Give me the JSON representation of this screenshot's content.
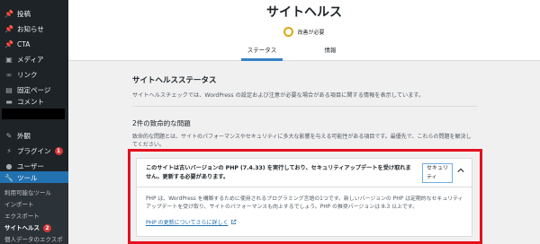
{
  "sidebar": {
    "items": [
      {
        "label": "投稿",
        "icon": "pin-icon",
        "glyph": "📌"
      },
      {
        "label": "お知らせ",
        "icon": "pin-icon",
        "glyph": "📌"
      },
      {
        "label": "CTA",
        "icon": "pin-icon",
        "glyph": "📌"
      },
      {
        "label": "メディア",
        "icon": "media-icon",
        "glyph": "▣"
      },
      {
        "label": "リンク",
        "icon": "link-icon",
        "glyph": "∞"
      },
      {
        "label": "固定ページ",
        "icon": "page-icon",
        "glyph": "▤"
      },
      {
        "label": "コメント",
        "icon": "comment-icon",
        "glyph": "▬"
      }
    ],
    "items2": [
      {
        "label": "外観",
        "icon": "appearance-icon",
        "glyph": "✎"
      },
      {
        "label": "プラグイン",
        "icon": "plugin-icon",
        "glyph": "⚡",
        "badge": "1"
      },
      {
        "label": "ユーザー",
        "icon": "user-icon",
        "glyph": "●"
      },
      {
        "label": "ツール",
        "icon": "tools-icon",
        "glyph": "🔧",
        "active": true
      }
    ],
    "submenu": [
      {
        "label": "利用可能なツール"
      },
      {
        "label": "インポート"
      },
      {
        "label": "エクスポート"
      },
      {
        "label": "サイトヘルス",
        "badge": "2",
        "current": true
      },
      {
        "label": "個人データのエクスポ"
      }
    ]
  },
  "header": {
    "title": "サイトヘルス",
    "status": "改善が必要",
    "status_color": "#dba617",
    "tabs": [
      {
        "label": "ステータス",
        "active": true
      },
      {
        "label": "情報"
      }
    ]
  },
  "main": {
    "section_title": "サイトヘルスステータス",
    "section_desc": "サイトヘルスチェックでは、WordPress の設定および注意が必要な場合がある項目に関する情報を表示しています。",
    "issues_title": "2件の致命的な問題",
    "issues_desc": "致命的な問題とは、サイトのパフォーマンスやセキュリティに多大な影響を与える可能性がある項目です。最優先で、これらの問題を解決してください。",
    "issue": {
      "heading": "このサイトは古いバージョンの PHP (7.4.33) を実行しており、セキュリティアップデートを受け取れません。更新する必要があります。",
      "badge": "セキュリティ",
      "body": "PHP は、WordPress を構築するために使用されるプログラミング言語の1つです。新しいバージョンの PHP は定期的なセキュリティアップデートを受け取り、サイトのパフォーマンスも向上するでしょう。PHP の推奨バージョンは 8.3 以上です。",
      "link": "PHP の更新についてさらに詳しく"
    }
  },
  "colors": {
    "sidebar_bg": "#1d2327",
    "accent": "#2271b1",
    "highlight": "#e4101f",
    "badge": "#d63638"
  }
}
